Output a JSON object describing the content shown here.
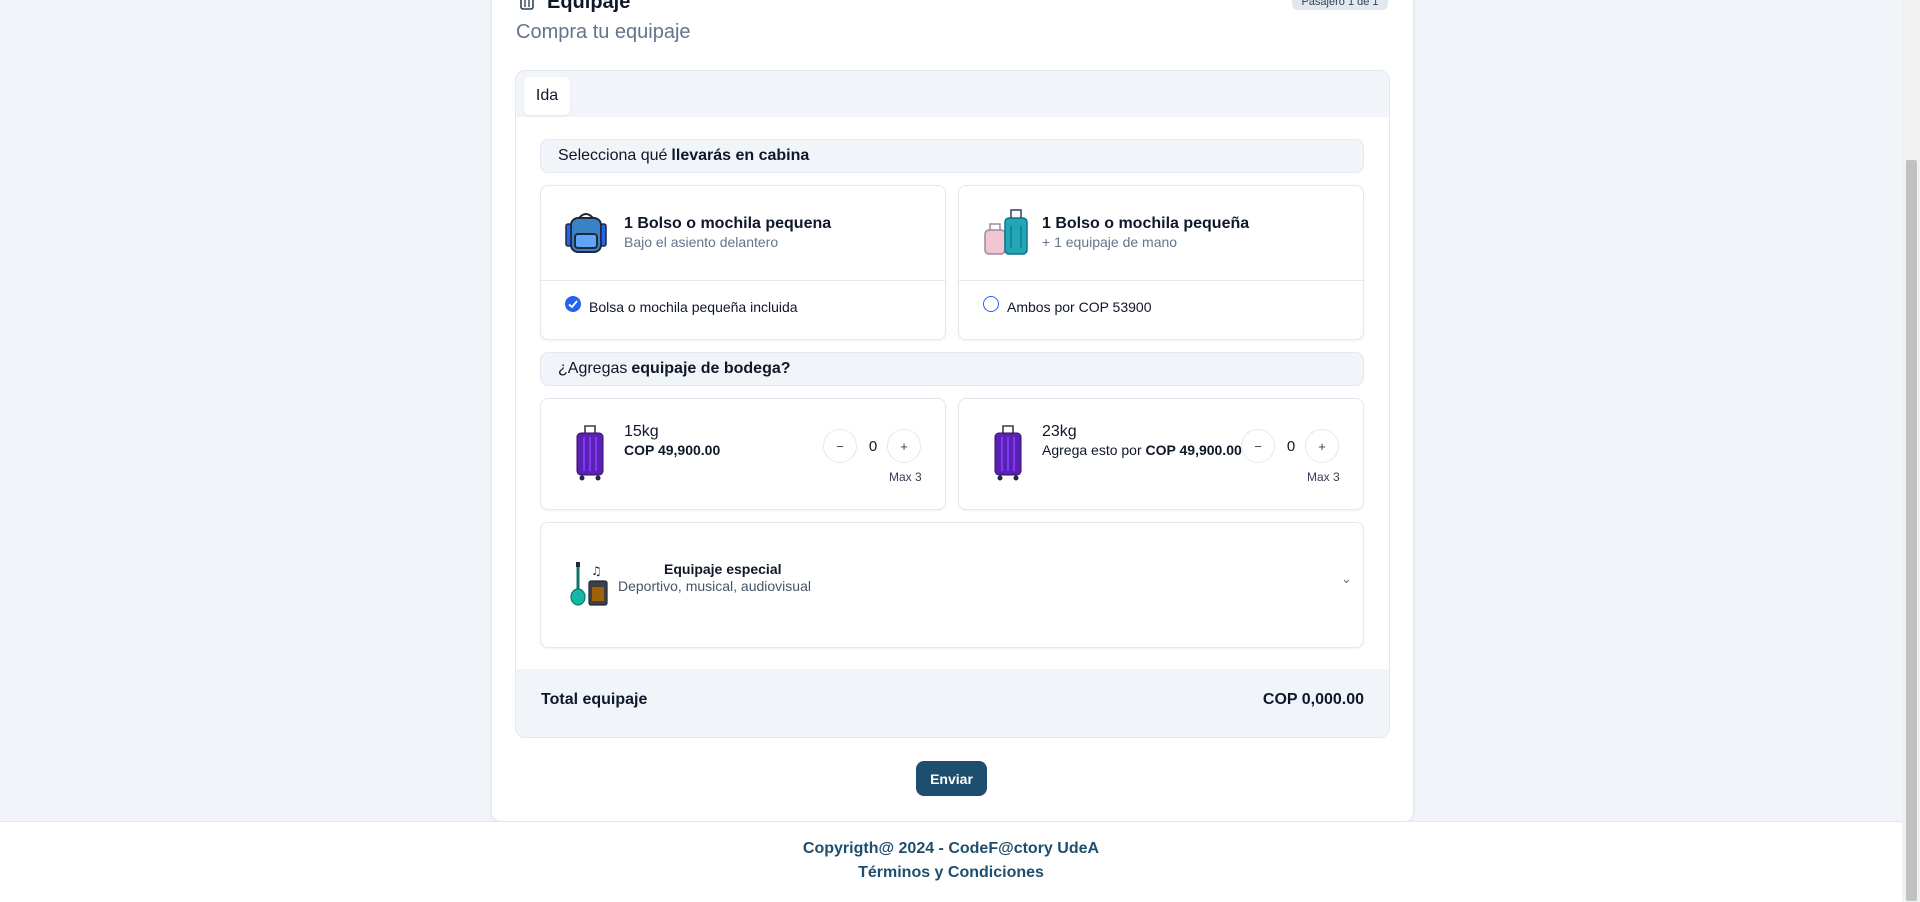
{
  "header": {
    "title": "Equipaje",
    "subtitle": "Compra tu equipaje",
    "passenger_badge": "Pasajero 1 de 1"
  },
  "tabs": [
    {
      "label": "Ida"
    }
  ],
  "cabin": {
    "prefix": "Selecciona qué",
    "bold": "llevarás en cabina",
    "options": [
      {
        "title": "1 Bolso o mochila pequena",
        "subtitle": "Bajo el asiento delantero",
        "label": "Bolsa o mochila pequeña incluida",
        "selected": true
      },
      {
        "title": "1 Bolso o mochila pequeña",
        "subtitle": "+ 1 equipaje de mano",
        "label": "Ambos por COP 53900",
        "selected": false
      }
    ]
  },
  "hold": {
    "prefix": "¿Agregas",
    "bold": "equipaje de bodega?",
    "options": [
      {
        "weight": "15kg",
        "price_prefix": "",
        "price": "COP 49,900.00",
        "qty": "0",
        "max": "Max 3",
        "minus": "−",
        "plus": "+"
      },
      {
        "weight": "23kg",
        "price_prefix": "Agrega esto por",
        "price": "COP 49,900.00",
        "qty": "0",
        "max": "Max 3",
        "minus": "−",
        "plus": "+"
      }
    ]
  },
  "special": {
    "title": "Equipaje especial",
    "subtitle": "Deportivo, musical, audiovisual",
    "chevron": "⌄"
  },
  "total": {
    "label": "Total equipaje",
    "value": "COP 0,000.00"
  },
  "send_label": "Enviar",
  "footer": {
    "copyright": "Copyrigth@ 2024 - CodeF@ctory UdeA",
    "terms": "Términos y Condiciones"
  },
  "colors": {
    "accent": "#1e4e6e",
    "check": "#2563eb",
    "suitcase": "#5b21b6"
  }
}
